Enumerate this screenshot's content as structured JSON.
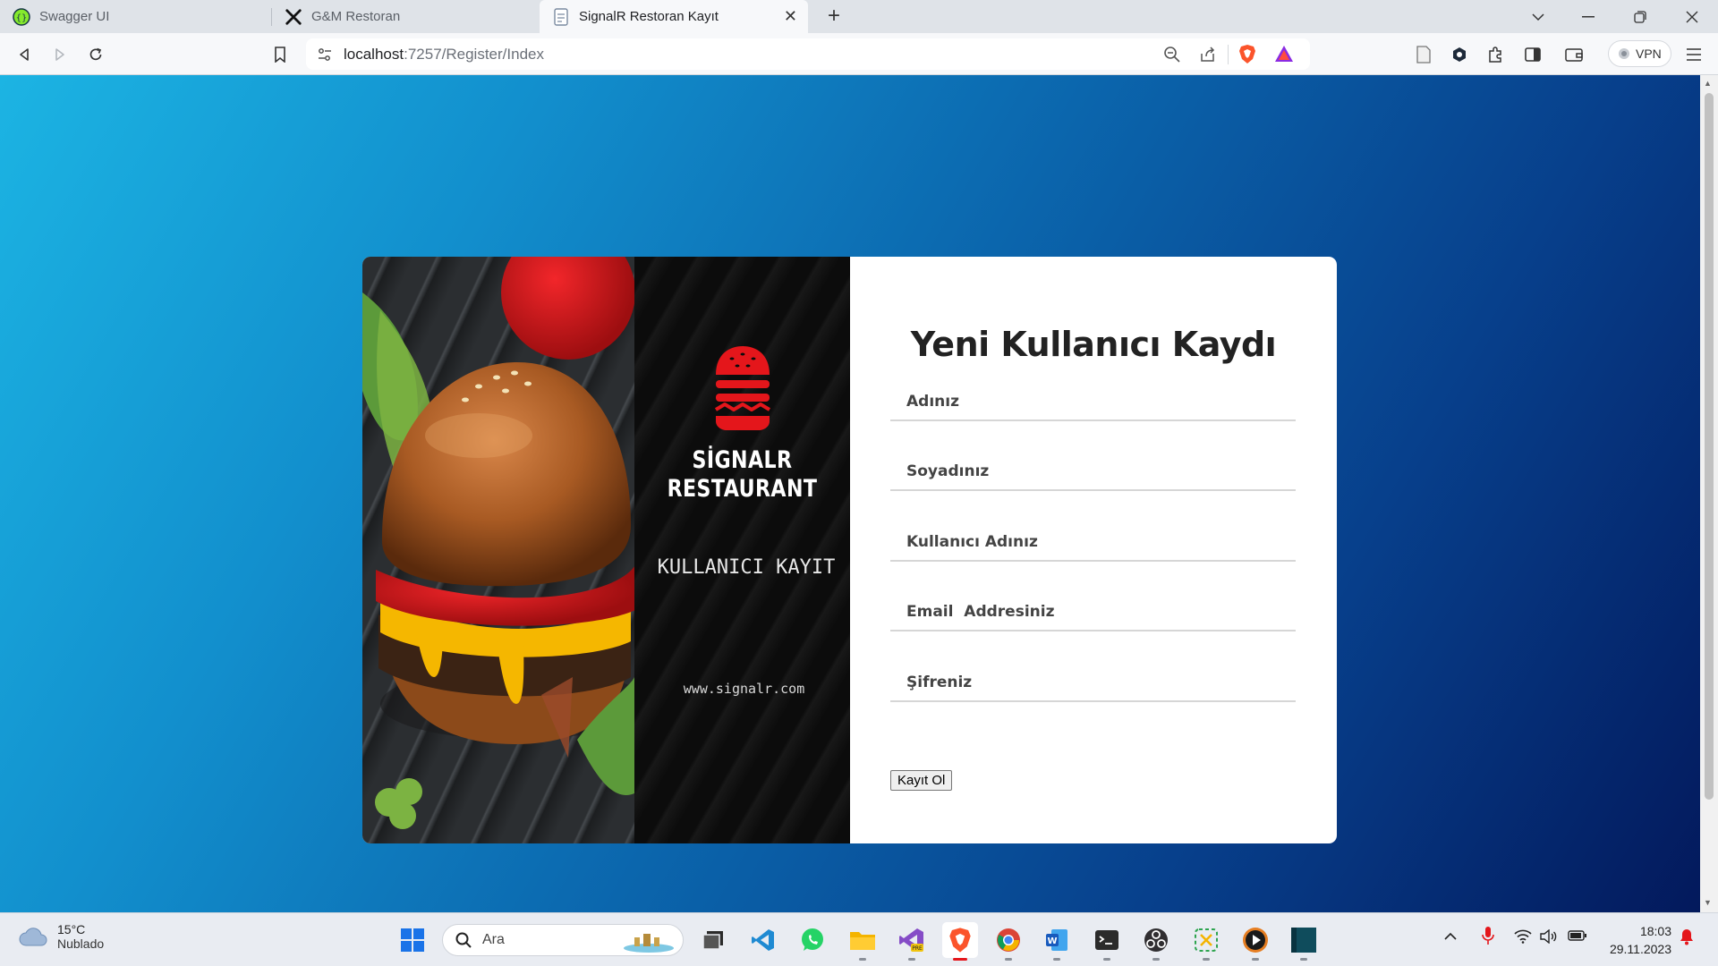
{
  "browser": {
    "tabs": [
      {
        "title": "Swagger UI",
        "icon": "swagger-icon"
      },
      {
        "title": "G&M Restoran",
        "icon": "utensils-icon"
      },
      {
        "title": "SignalR Restoran Kayıt",
        "icon": "page-icon",
        "active": true
      }
    ],
    "address": {
      "host": "localhost",
      "path": ":7257/Register/Index"
    },
    "vpn_label": "VPN"
  },
  "page": {
    "brand": {
      "line1": "SİGNALR",
      "line2": "RESTAURANT",
      "subtitle": "KULLANICI KAYIT",
      "website": "www.signalr.com"
    },
    "form": {
      "title": "Yeni Kullanıcı Kaydı",
      "fields": [
        {
          "placeholder": "Adınız"
        },
        {
          "placeholder": "Soyadınız"
        },
        {
          "placeholder": "Kullanıcı Adınız"
        },
        {
          "placeholder": "Email  Addresiniz"
        },
        {
          "placeholder": "Şifreniz"
        }
      ],
      "submit_label": "Kayıt Ol"
    },
    "colors": {
      "bg_start": "#1cb4e3",
      "bg_end": "#03195c",
      "brand_red": "#e4161b"
    }
  },
  "taskbar": {
    "weather": {
      "temp": "15°C",
      "condition": "Nublado"
    },
    "search_placeholder": "Ara",
    "clock": {
      "time": "18:03",
      "date": "29.11.2023"
    }
  }
}
